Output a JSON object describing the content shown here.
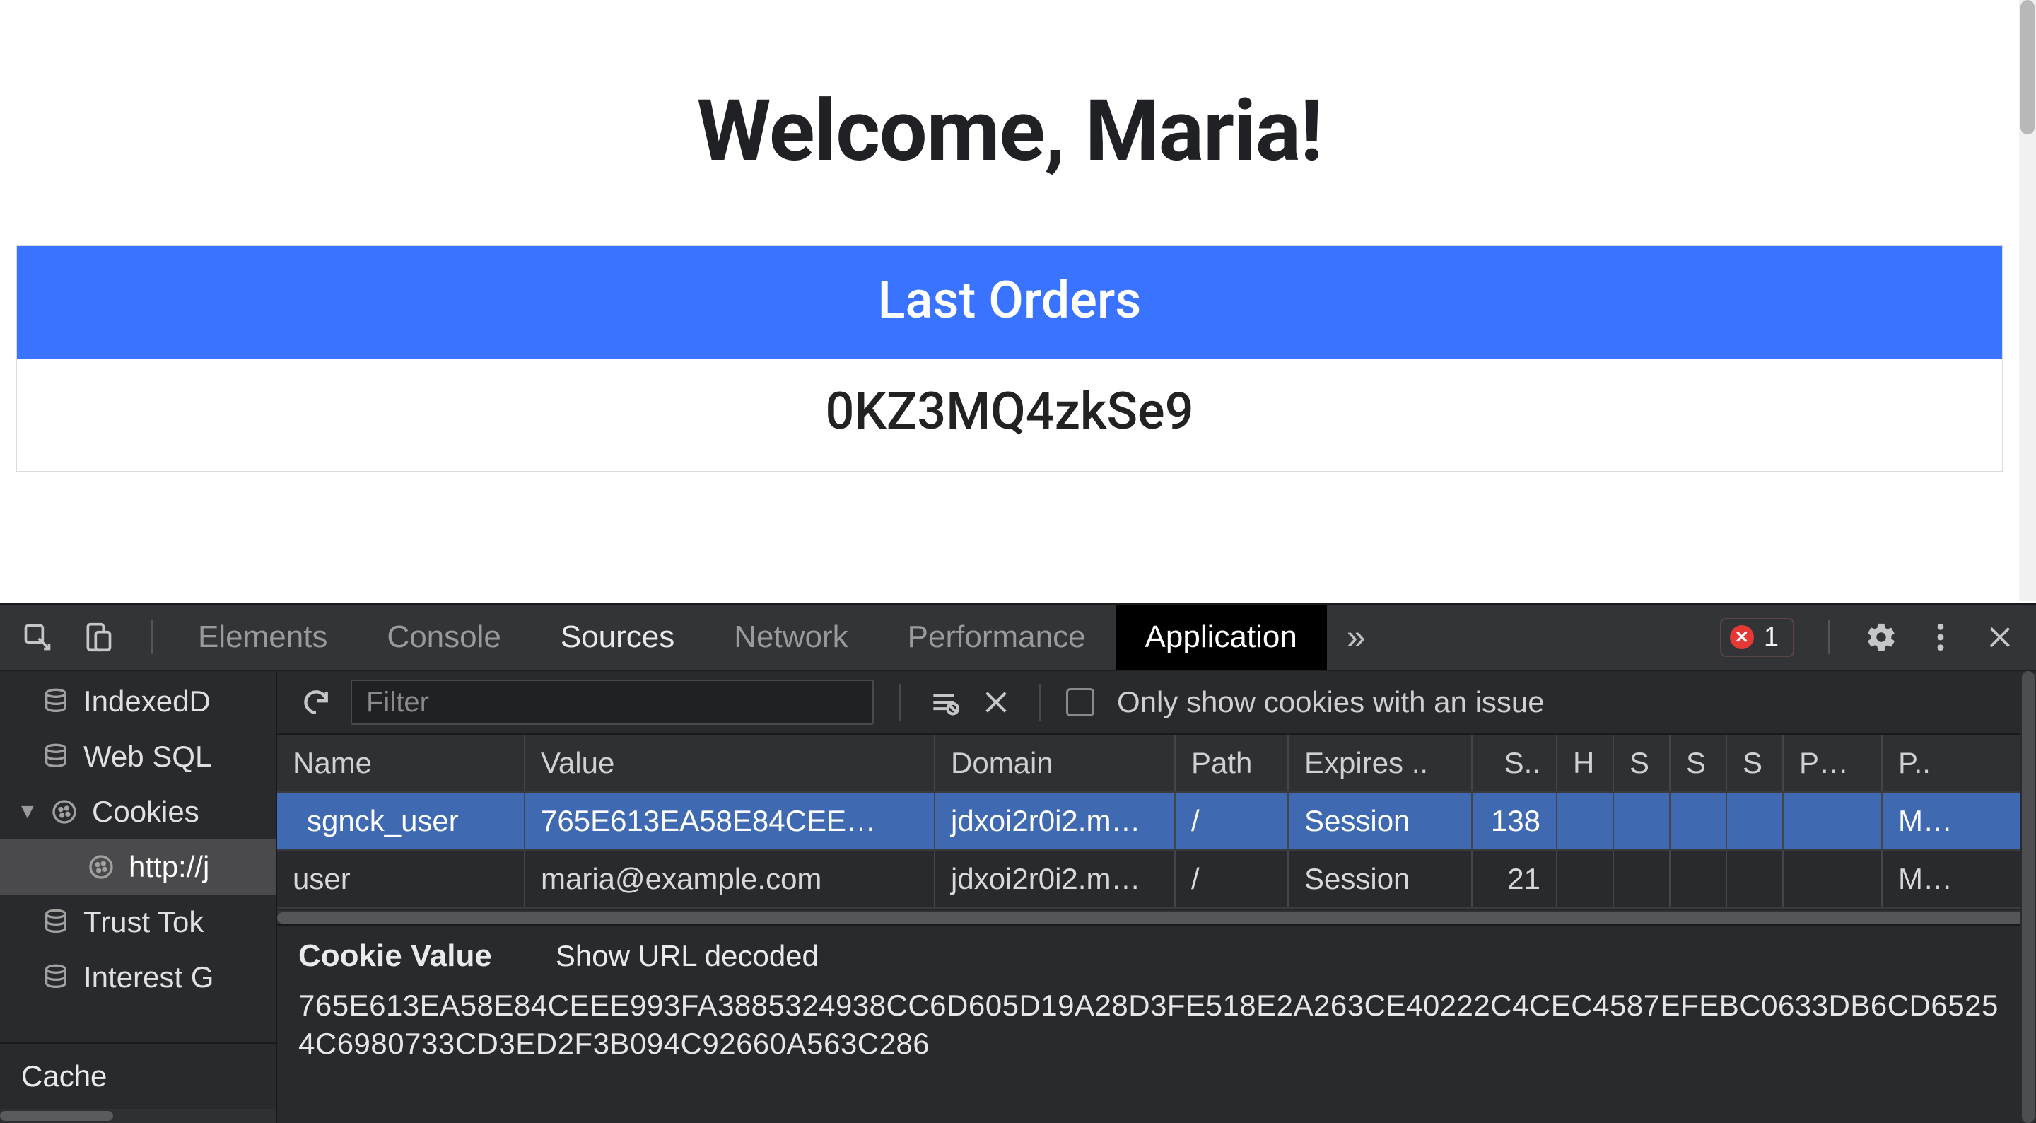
{
  "page": {
    "welcome": "Welcome, Maria!",
    "orders_header": "Last Orders",
    "order_id": "0KZ3MQ4zkSe9"
  },
  "devtools": {
    "tabs": {
      "elements": "Elements",
      "console": "Console",
      "sources": "Sources",
      "network": "Network",
      "performance": "Performance",
      "application": "Application",
      "more": "»"
    },
    "errors_count": "1",
    "sidebar": {
      "indexeddb": "IndexedD",
      "websql": "Web SQL",
      "cookies": "Cookies",
      "cookies_origin": "http://j",
      "trust_tokens": "Trust Tok",
      "interest_groups": "Interest G",
      "cache": "Cache"
    },
    "toolbar": {
      "filter_placeholder": "Filter",
      "only_issues": "Only show cookies with an issue"
    },
    "table": {
      "headers": {
        "name": "Name",
        "value": "Value",
        "domain": "Domain",
        "path": "Path",
        "expires": "Expires ..",
        "size": "S..",
        "h": "H",
        "s1": "S",
        "s2": "S",
        "s3": "S",
        "p1": "P…",
        "p2": "P.."
      },
      "rows": [
        {
          "name": "sgnck_user",
          "value": "765E613EA58E84CEE…",
          "domain": "jdxoi2r0i2.m…",
          "path": "/",
          "expires": "Session",
          "size": "138",
          "h": "",
          "s1": "",
          "s2": "",
          "s3": "",
          "p1": "",
          "p2": "M…",
          "selected": true
        },
        {
          "name": "user",
          "value": "maria@example.com",
          "domain": "jdxoi2r0i2.m…",
          "path": "/",
          "expires": "Session",
          "size": "21",
          "h": "",
          "s1": "",
          "s2": "",
          "s3": "",
          "p1": "",
          "p2": "M…",
          "selected": false
        }
      ]
    },
    "cookie_value": {
      "title": "Cookie Value",
      "show_decoded": "Show URL decoded",
      "value": "765E613EA58E84CEEE993FA3885324938CC6D605D19A28D3FE518E2A263CE40222C4CEC4587EFEBC0633DB6CD65254C6980733CD3ED2F3B094C92660A563C286"
    }
  }
}
